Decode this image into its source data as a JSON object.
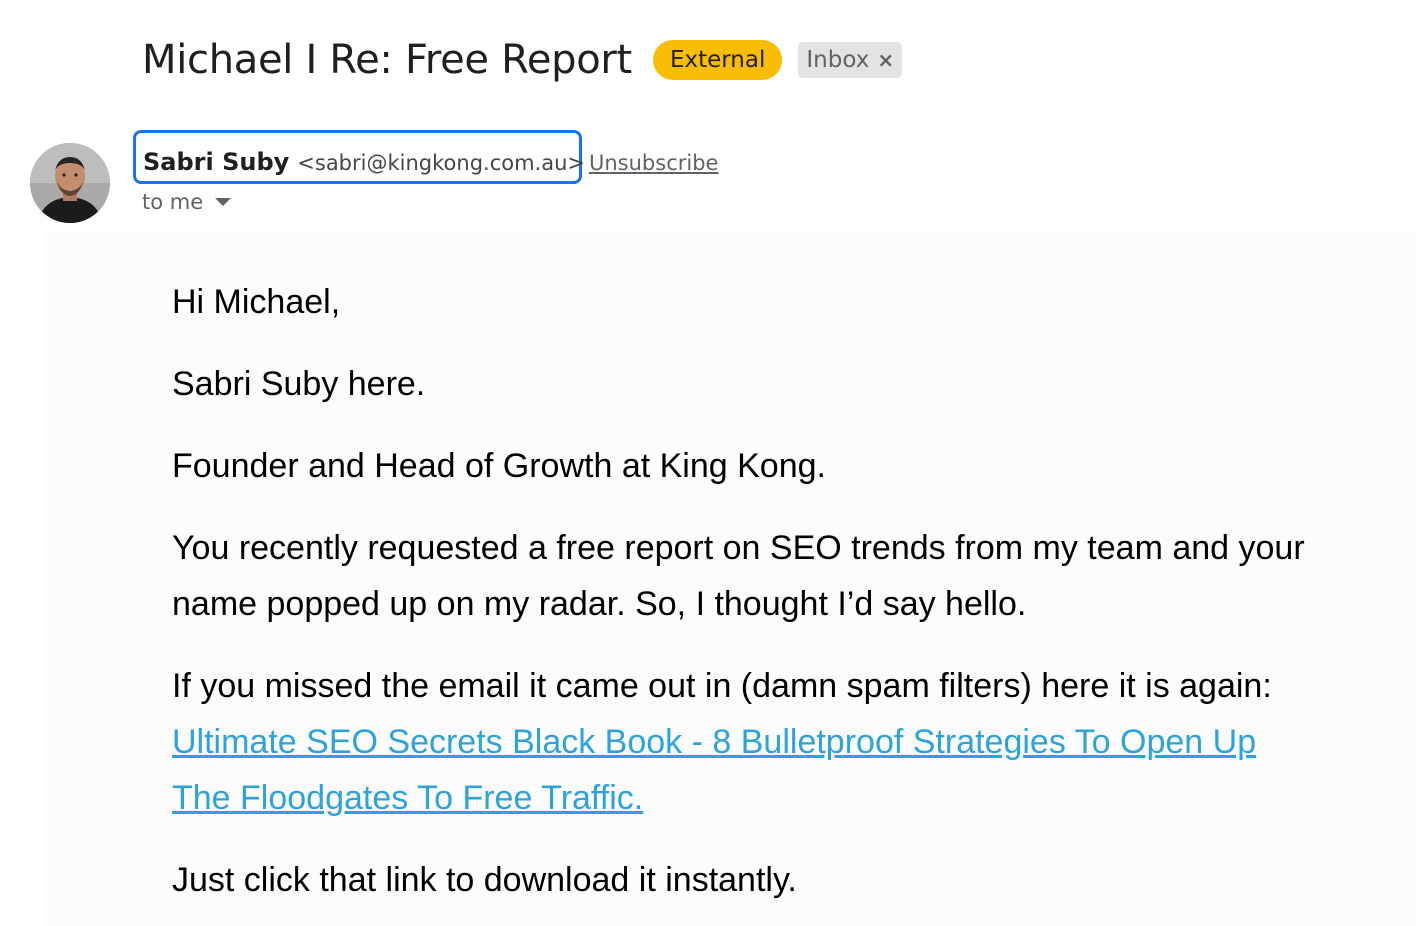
{
  "email": {
    "subject": "Michael I Re: Free Report",
    "external_badge": "External",
    "inbox_label": "Inbox",
    "remove_label_glyph": "×"
  },
  "sender": {
    "name": "Sabri Suby",
    "email": "<sabri@kingkong.com.au>",
    "unsubscribe": "Unsubscribe",
    "recipient": "to me"
  },
  "body": {
    "greeting": "Hi Michael,",
    "intro": "Sabri Suby here.",
    "title_line": "Founder and Head of Growth at King Kong.",
    "paragraph_request": "You recently requested a free report on SEO trends from my team and your name popped up on my radar. So, I thought I’d say hello.",
    "paragraph_missed_prefix": "If you missed the email it came out in (damn spam filters) here it is again: ",
    "report_link": "Ultimate SEO Secrets Black Book - 8 Bulletproof Strategies To Open Up The Floodgates To Free Traffic.",
    "closing": "Just click that link to download it instantly."
  },
  "colors": {
    "external_badge": "#fbbc04",
    "focus_outline": "#1a73e8",
    "link": "#2ea3d9"
  },
  "icons": {
    "remove_label": "close-icon",
    "recipient_details": "caret-down-icon"
  }
}
